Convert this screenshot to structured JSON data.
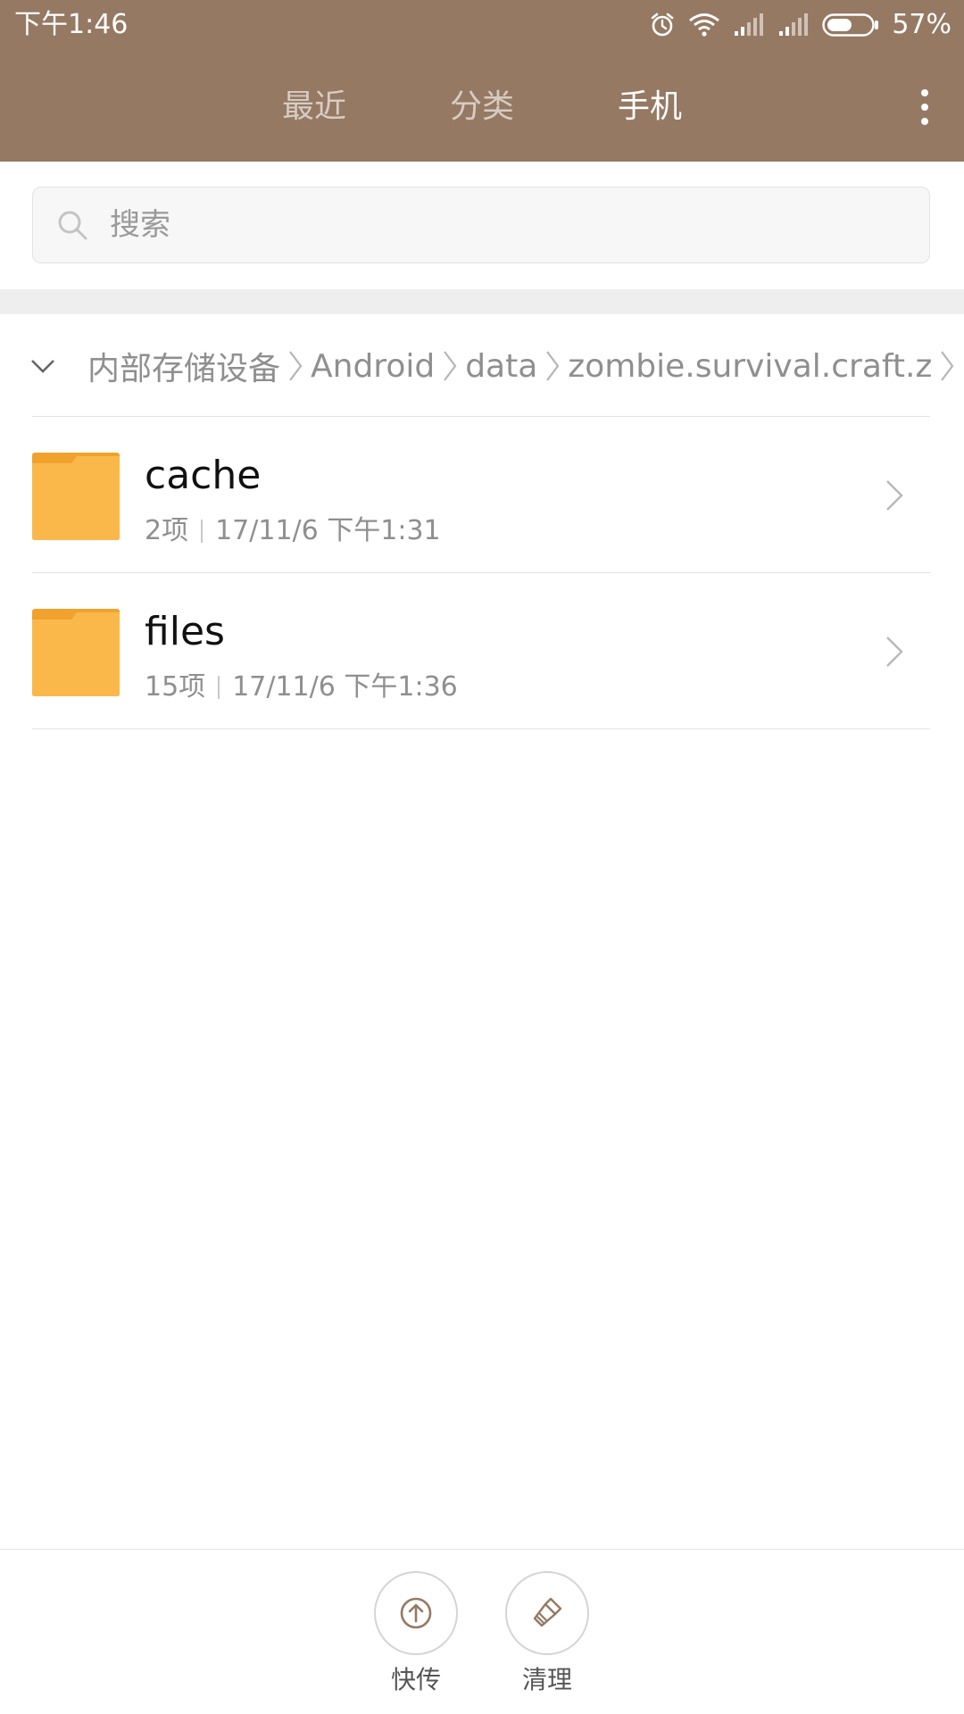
{
  "status_bar": {
    "time": "下午1:46",
    "battery_percent": "57%",
    "battery_level": 0.57,
    "icons": [
      "alarm-icon",
      "wifi-icon",
      "signal-icon",
      "signal-icon",
      "battery-icon"
    ]
  },
  "tabs": [
    {
      "label": "最近",
      "active": false
    },
    {
      "label": "分类",
      "active": false
    },
    {
      "label": "手机",
      "active": true
    }
  ],
  "search": {
    "placeholder": "搜索",
    "value": ""
  },
  "breadcrumb": [
    "内部存储设备",
    "Android",
    "data",
    "zombie.survival.craft.z"
  ],
  "files": [
    {
      "name": "cache",
      "count": "2项",
      "date": "17/11/6 下午1:31"
    },
    {
      "name": "files",
      "count": "15项",
      "date": "17/11/6 下午1:36"
    }
  ],
  "actions": [
    {
      "label": "快传",
      "icon": "upload-icon"
    },
    {
      "label": "清理",
      "icon": "broom-icon"
    }
  ],
  "colors": {
    "header": "#957963",
    "folder": "#FBB84A",
    "folder_tab": "#F0A22D",
    "accent_icon": "#957963"
  }
}
